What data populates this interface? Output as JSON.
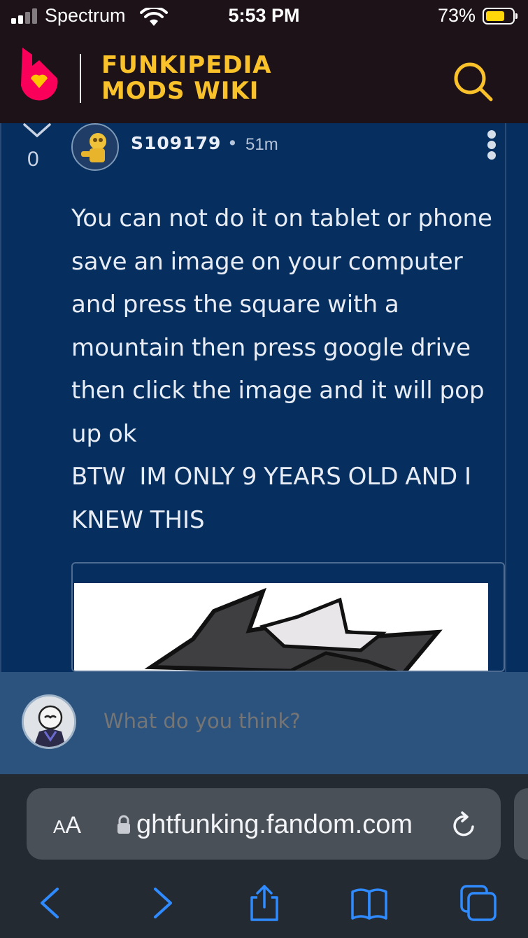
{
  "status_bar": {
    "carrier": "Spectrum",
    "time": "5:53 PM",
    "battery_percent": "73%",
    "battery_level": 0.73
  },
  "header": {
    "wiki_title_line1": "FUNKIPEDIA",
    "wiki_title_line2": "MODS WIKI",
    "accent_color": "#f9c22b",
    "logo_icon": "fandom-flame-icon",
    "search_icon": "search-icon"
  },
  "comment": {
    "vote_count": "0",
    "author": "S109179",
    "separator": "•",
    "time_ago": "51m",
    "body": "You can not do it on tablet or phone save an image on your computer and press the square with a mountain then press google drive then click the image and it will pop up ok\nBTW  IM ONLY 9 YEARS OLD AND I KNEW THIS"
  },
  "reply": {
    "placeholder": "What do you think?"
  },
  "browser": {
    "aa_label_big": "A",
    "aa_label_small": "A",
    "url": "ghtfunking.fandom.com"
  }
}
